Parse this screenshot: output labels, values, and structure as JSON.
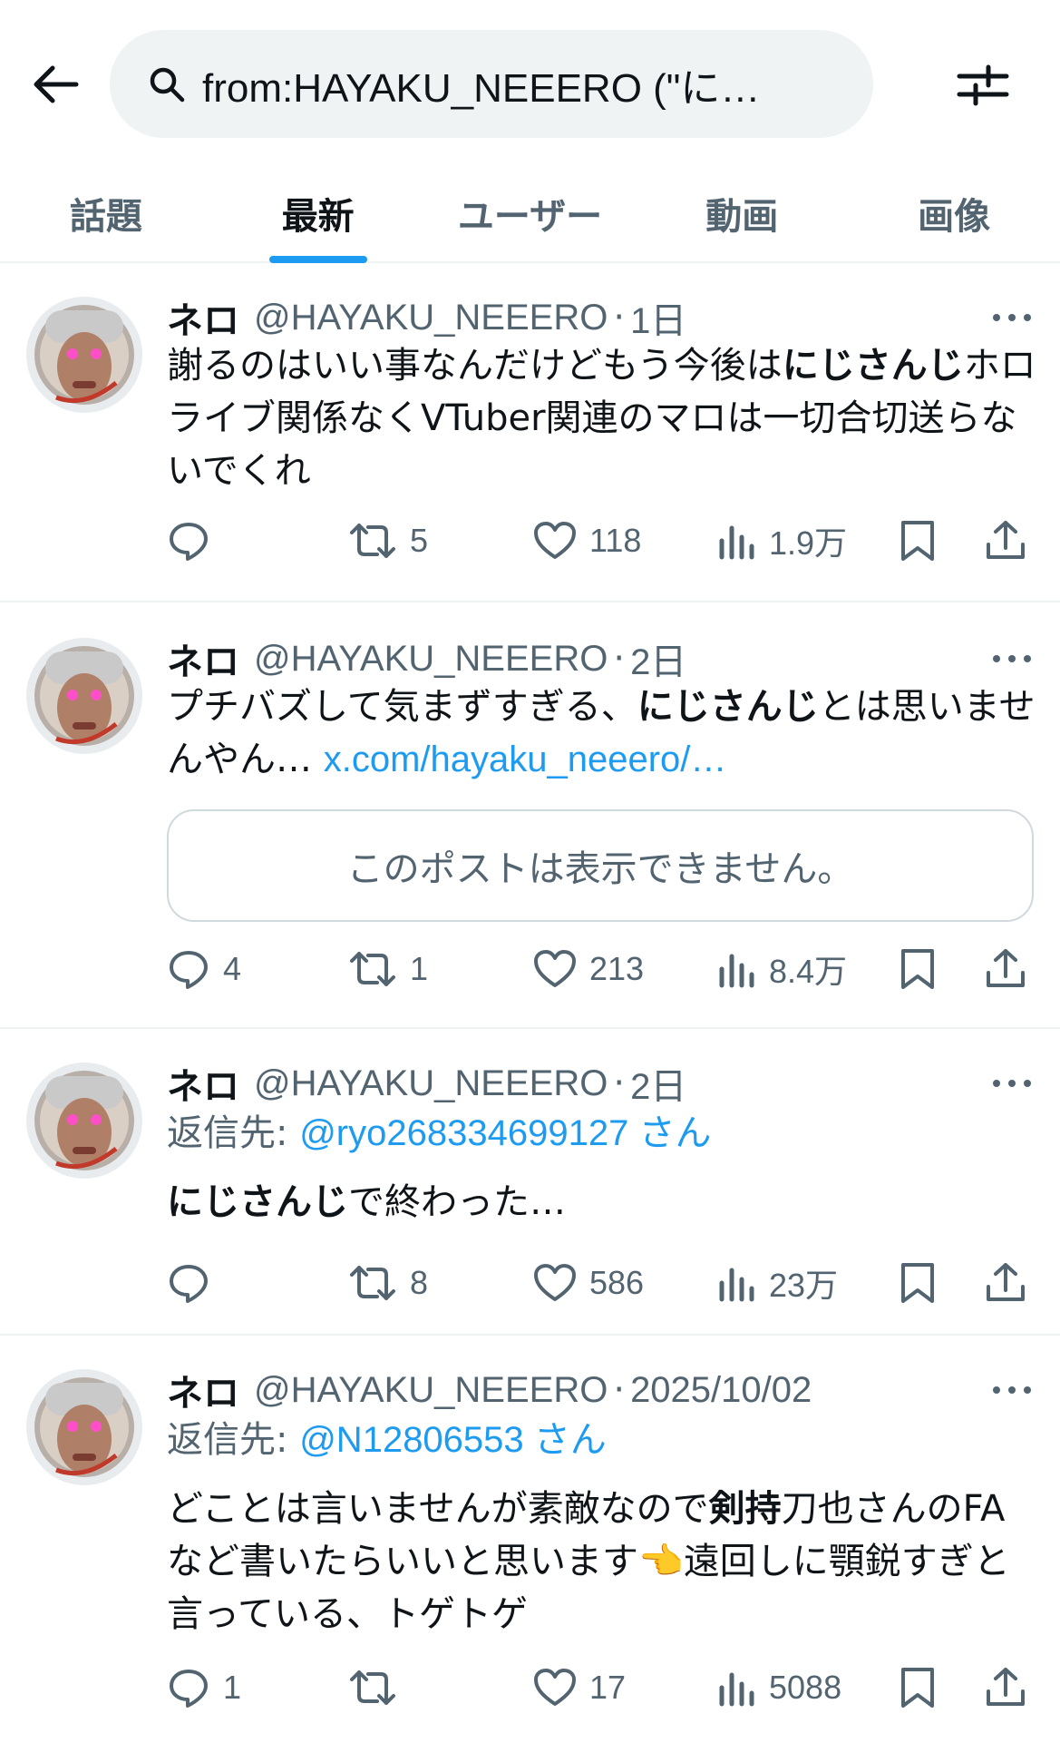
{
  "search": {
    "query": "from:HAYAKU_NEEERO (\"に…"
  },
  "tabs": [
    {
      "label": "話題"
    },
    {
      "label": "最新"
    },
    {
      "label": "ユーザー"
    },
    {
      "label": "動画"
    },
    {
      "label": "画像"
    }
  ],
  "active_tab": "最新",
  "accent_color": "#1d9bf0",
  "tweets": [
    {
      "name": "ネロ",
      "handle": "@HAYAKU_NEEERO",
      "separator": "·",
      "time": "1日",
      "text_parts": [
        {
          "t": "謝るのはいい事なんだけどもう今後は",
          "b": false
        },
        {
          "t": "にじさんじ",
          "b": true
        },
        {
          "t": "ホロライブ関係なくVTuber関連のマロは一切合切送らないでくれ",
          "b": false
        }
      ],
      "replies": "",
      "reposts": "5",
      "likes": "118",
      "views": "1.9万"
    },
    {
      "name": "ネロ",
      "handle": "@HAYAKU_NEEERO",
      "separator": "·",
      "time": "2日",
      "text_parts": [
        {
          "t": "プチバズして気まずすぎる、",
          "b": false
        },
        {
          "t": "にじさんじ",
          "b": true
        },
        {
          "t": "とは思いませんやん… ",
          "b": false
        }
      ],
      "link": "x.com/hayaku_neeero/…",
      "card_text": "このポストは表示できません。",
      "replies": "4",
      "reposts": "1",
      "likes": "213",
      "views": "8.4万"
    },
    {
      "name": "ネロ",
      "handle": "@HAYAKU_NEEERO",
      "separator": "·",
      "time": "2日",
      "reply_prefix": "返信先: ",
      "reply_to": "@ryo268334699127 さん",
      "text_parts": [
        {
          "t": "にじさんじ",
          "b": true
        },
        {
          "t": "で終わった…",
          "b": false
        }
      ],
      "replies": "",
      "reposts": "8",
      "likes": "586",
      "views": "23万"
    },
    {
      "name": "ネロ",
      "handle": "@HAYAKU_NEEERO",
      "separator": "·",
      "time": "2025/10/02",
      "reply_prefix": "返信先: ",
      "reply_to": "@N12806553 さん",
      "text_parts": [
        {
          "t": "どことは言いませんが素敵なので",
          "b": false
        },
        {
          "t": "剣持",
          "b": true
        },
        {
          "t": "刀也さんのFAなど書いたらいいと思います👈遠回しに顎鋭すぎと言っている、トゲトゲ",
          "b": false
        }
      ],
      "replies": "1",
      "reposts": "",
      "likes": "17",
      "views": "5088"
    }
  ]
}
